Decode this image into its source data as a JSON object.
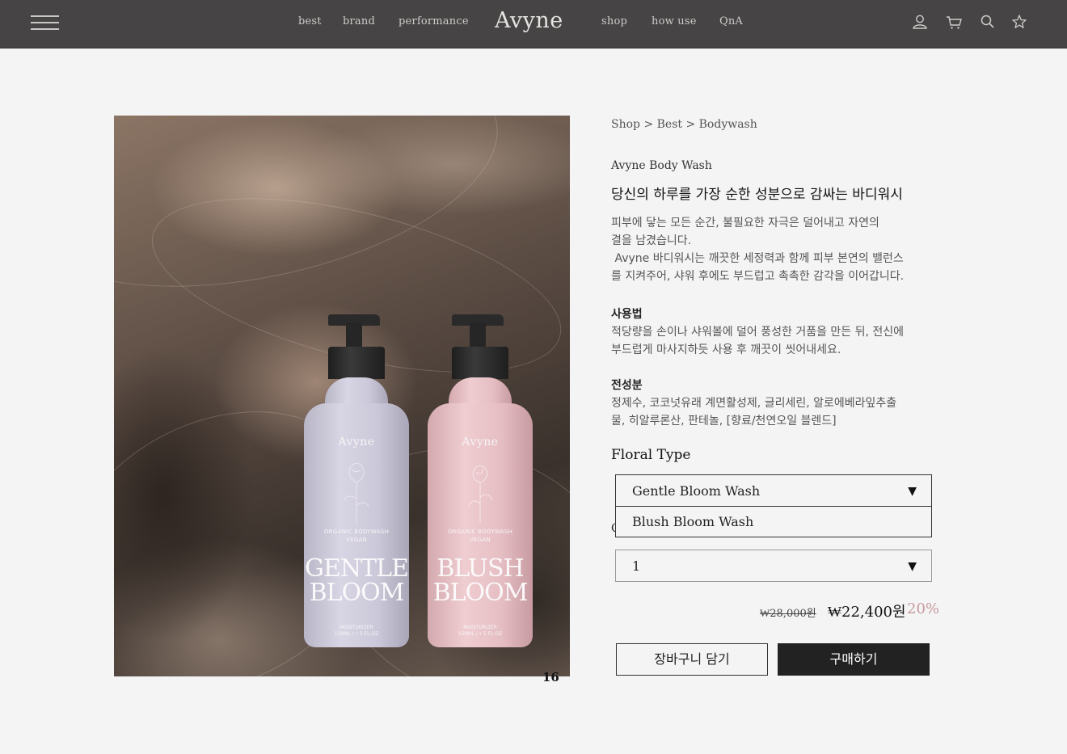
{
  "header": {
    "nav_left": [
      "best",
      "brand",
      "performance"
    ],
    "logo": "Avyne",
    "nav_right": [
      "shop",
      "how use",
      "QnA"
    ],
    "icons": [
      "user-icon",
      "cart-icon",
      "search-icon",
      "star-icon"
    ],
    "colors": {
      "bar": "#464444",
      "text": "#cfccca"
    }
  },
  "gallery": {
    "page_number": "16",
    "bottles": [
      {
        "brand": "Avyne",
        "sub1": "ORGANIC BODYWASH",
        "sub2": "VEGAN",
        "name1": "GENTLE",
        "name2": "BLOOM",
        "vol1": "MOISTURIZER",
        "vol2": "150ML / • 5 FL.OZ",
        "color": "#cbc8d9"
      },
      {
        "brand": "Avyne",
        "sub1": "ORGANIC BODYWASH",
        "sub2": "VEGAN",
        "name1": "BLUSH",
        "name2": "BLOOM",
        "vol1": "MOISTURIZER",
        "vol2": "150ML / • 5 FL.OZ",
        "color": "#e5bec3"
      }
    ]
  },
  "product": {
    "breadcrumb": "Shop > Best > Bodywash",
    "name_en": "Avyne Body Wash",
    "headline_ko": "당신의 하루를 가장 순한 성분으로 감싸는 바디워시",
    "description": [
      "피부에 닿는 모든 순간, 불필요한 자극은 덜어내고 자연의",
      "결을 남겼습니다.",
      " Avyne 바디워시는 깨끗한 세정력과 함께 피부 본연의 밸런스",
      "를 지켜주어, 샤워 후에도 부드럽고 촉촉한 감각을 이어갑니다."
    ],
    "usage_title": "사용법",
    "usage": [
      "적당량을 손이나 샤워볼에 덜어 풍성한 거품을 만든 뒤, 전신에",
      "부드럽게 마사지하듯 사용 후 깨끗이 씻어내세요."
    ],
    "ingredients_title": "전성분",
    "ingredients": [
      "정제수, 코코넛유래 계면활성제, 글리세린, 알로에베라잎추출",
      "물, 히알루론산, 판테놀, [향료/천연오일 블렌드]"
    ]
  },
  "options": {
    "floral_label": "Floral Type",
    "floral_selected": "Gentle Bloom Wash",
    "floral_option_open": "Blush Bloom Wash",
    "quantity_label_partial": "Q",
    "quantity_value": "1",
    "caret": "▼"
  },
  "pricing": {
    "original": "₩28,000원",
    "sale": "₩22,400원",
    "discount": "20%",
    "discount_color": "#c7999e"
  },
  "actions": {
    "cart_label": "장바구니 담기",
    "buy_label": "구매하기"
  }
}
